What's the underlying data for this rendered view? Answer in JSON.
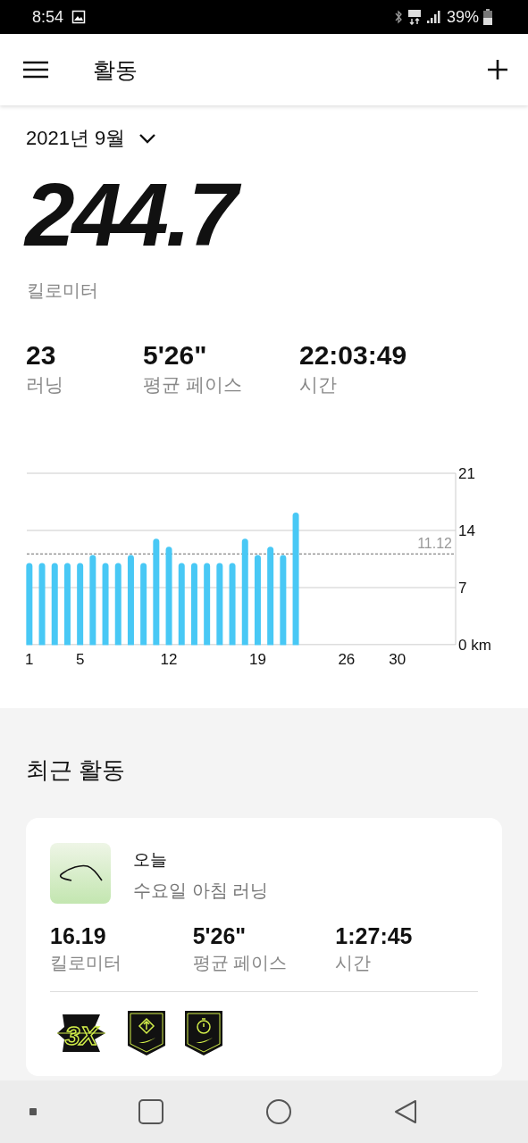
{
  "status_bar": {
    "time": "8:54",
    "battery": "39%"
  },
  "app_bar": {
    "title": "활동"
  },
  "period": {
    "label": "2021년 9월"
  },
  "total": {
    "value": "244.7",
    "unit": "킬로미터"
  },
  "stats": [
    {
      "value": "23",
      "label": "러닝"
    },
    {
      "value": "5'26\"",
      "label": "평균 페이스"
    },
    {
      "value": "22:03:49",
      "label": "시간"
    }
  ],
  "chart": {
    "chart_data": {
      "type": "bar",
      "x": [
        1,
        2,
        3,
        4,
        5,
        6,
        7,
        8,
        9,
        10,
        11,
        12,
        13,
        14,
        15,
        16,
        17,
        18,
        19,
        20,
        21,
        22
      ],
      "series": [
        {
          "color": "#48c8f5",
          "values": [
            10,
            10,
            10,
            10,
            10,
            11,
            10,
            10,
            11,
            10,
            13,
            12,
            10,
            10,
            10,
            10,
            10,
            13,
            11,
            12,
            11,
            16.2
          ]
        }
      ],
      "xlim": [
        0.8,
        34.6
      ],
      "ylim": [
        0,
        21
      ],
      "xticks": [
        1,
        5,
        12,
        19,
        26,
        30
      ],
      "yticks": [
        {
          "value": 0,
          "label": "0 km"
        },
        7,
        14,
        21
      ],
      "ref_lines": [
        {
          "axis": "y",
          "value": 11.12,
          "label": "11.12"
        }
      ]
    }
  },
  "recent": {
    "heading": "최근 활동",
    "card": {
      "date": "오늘",
      "title": "수요일 아침 러닝",
      "stats": [
        {
          "value": "16.19",
          "label": "킬로미터"
        },
        {
          "value": "5'26\"",
          "label": "평균 페이스"
        },
        {
          "value": "1:27:45",
          "label": "시간"
        }
      ],
      "badges": [
        {
          "kind": "streak",
          "label": "3X"
        },
        {
          "kind": "pace"
        },
        {
          "kind": "timer"
        }
      ]
    }
  }
}
